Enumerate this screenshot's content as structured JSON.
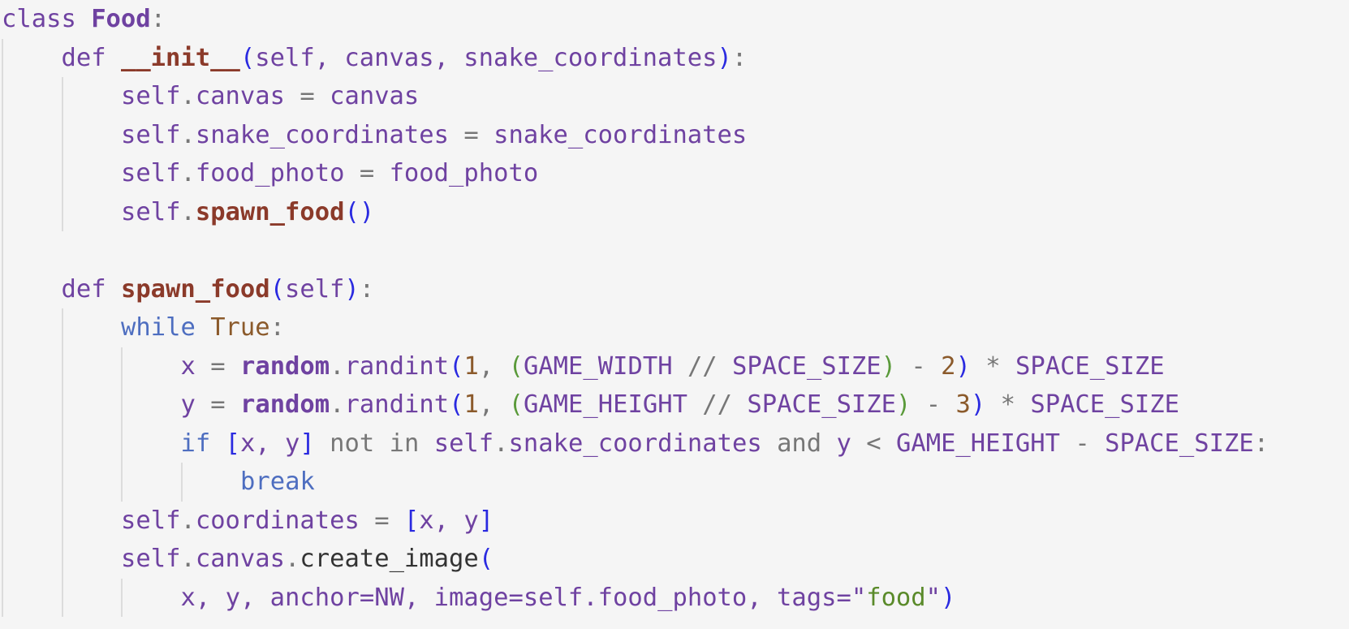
{
  "lines": [
    {
      "indent": 0,
      "guides": [],
      "tokens": [
        [
          "kw",
          "class "
        ],
        [
          "cls",
          "Food"
        ],
        [
          "op",
          ":"
        ]
      ]
    },
    {
      "indent": 1,
      "guides": [
        0
      ],
      "tokens": [
        [
          "kw",
          "def "
        ],
        [
          "fn",
          "__init__"
        ],
        [
          "p1",
          "("
        ],
        [
          "plain",
          "self, canvas, snake_coordinates"
        ],
        [
          "p1",
          ")"
        ],
        [
          "op",
          ":"
        ]
      ]
    },
    {
      "indent": 2,
      "guides": [
        0,
        1
      ],
      "tokens": [
        [
          "plain",
          "self"
        ],
        [
          "op",
          "."
        ],
        [
          "plain",
          "canvas "
        ],
        [
          "op",
          "= "
        ],
        [
          "plain",
          "canvas"
        ]
      ]
    },
    {
      "indent": 2,
      "guides": [
        0,
        1
      ],
      "tokens": [
        [
          "plain",
          "self"
        ],
        [
          "op",
          "."
        ],
        [
          "plain",
          "snake_coordinates "
        ],
        [
          "op",
          "= "
        ],
        [
          "plain",
          "snake_coordinates"
        ]
      ]
    },
    {
      "indent": 2,
      "guides": [
        0,
        1
      ],
      "tokens": [
        [
          "plain",
          "self"
        ],
        [
          "op",
          "."
        ],
        [
          "plain",
          "food_photo "
        ],
        [
          "op",
          "= "
        ],
        [
          "plain",
          "food_photo"
        ]
      ]
    },
    {
      "indent": 2,
      "guides": [
        0,
        1
      ],
      "tokens": [
        [
          "plain",
          "self"
        ],
        [
          "op",
          "."
        ],
        [
          "fn",
          "spawn_food"
        ],
        [
          "p1",
          "()"
        ]
      ]
    },
    {
      "indent": 0,
      "guides": [
        0
      ],
      "tokens": []
    },
    {
      "indent": 1,
      "guides": [
        0
      ],
      "tokens": [
        [
          "kw",
          "def "
        ],
        [
          "fn",
          "spawn_food"
        ],
        [
          "p1",
          "("
        ],
        [
          "plain",
          "self"
        ],
        [
          "p1",
          ")"
        ],
        [
          "op",
          ":"
        ]
      ]
    },
    {
      "indent": 2,
      "guides": [
        0,
        1
      ],
      "tokens": [
        [
          "ctl",
          "while "
        ],
        [
          "const",
          "True"
        ],
        [
          "op",
          ":"
        ]
      ]
    },
    {
      "indent": 3,
      "guides": [
        0,
        1,
        2
      ],
      "tokens": [
        [
          "plain",
          "x "
        ],
        [
          "op",
          "= "
        ],
        [
          "mod",
          "random"
        ],
        [
          "op",
          "."
        ],
        [
          "plain",
          "randint"
        ],
        [
          "p1",
          "("
        ],
        [
          "num",
          "1"
        ],
        [
          "op",
          ", "
        ],
        [
          "p2",
          "("
        ],
        [
          "plain",
          "GAME_WIDTH "
        ],
        [
          "op",
          "// "
        ],
        [
          "plain",
          "SPACE_SIZE"
        ],
        [
          "p2",
          ")"
        ],
        [
          "op",
          " - "
        ],
        [
          "num",
          "2"
        ],
        [
          "p1",
          ")"
        ],
        [
          "op",
          " * "
        ],
        [
          "plain",
          "SPACE_SIZE"
        ]
      ]
    },
    {
      "indent": 3,
      "guides": [
        0,
        1,
        2
      ],
      "tokens": [
        [
          "plain",
          "y "
        ],
        [
          "op",
          "= "
        ],
        [
          "mod",
          "random"
        ],
        [
          "op",
          "."
        ],
        [
          "plain",
          "randint"
        ],
        [
          "p1",
          "("
        ],
        [
          "num",
          "1"
        ],
        [
          "op",
          ", "
        ],
        [
          "p2",
          "("
        ],
        [
          "plain",
          "GAME_HEIGHT "
        ],
        [
          "op",
          "// "
        ],
        [
          "plain",
          "SPACE_SIZE"
        ],
        [
          "p2",
          ")"
        ],
        [
          "op",
          " - "
        ],
        [
          "num",
          "3"
        ],
        [
          "p1",
          ")"
        ],
        [
          "op",
          " * "
        ],
        [
          "plain",
          "SPACE_SIZE"
        ]
      ]
    },
    {
      "indent": 3,
      "guides": [
        0,
        1,
        2
      ],
      "tokens": [
        [
          "ctl",
          "if "
        ],
        [
          "p1",
          "["
        ],
        [
          "plain",
          "x, y"
        ],
        [
          "p1",
          "]"
        ],
        [
          "op",
          " not in "
        ],
        [
          "plain",
          "self"
        ],
        [
          "op",
          "."
        ],
        [
          "plain",
          "snake_coordinates "
        ],
        [
          "op",
          "and "
        ],
        [
          "plain",
          "y "
        ],
        [
          "op",
          "< "
        ],
        [
          "plain",
          "GAME_HEIGHT "
        ],
        [
          "op",
          "- "
        ],
        [
          "plain",
          "SPACE_SIZE"
        ],
        [
          "op",
          ":"
        ]
      ]
    },
    {
      "indent": 4,
      "guides": [
        0,
        1,
        2,
        3
      ],
      "tokens": [
        [
          "ctl",
          "break"
        ]
      ]
    },
    {
      "indent": 2,
      "guides": [
        0,
        1
      ],
      "tokens": [
        [
          "plain",
          "self"
        ],
        [
          "op",
          "."
        ],
        [
          "plain",
          "coordinates "
        ],
        [
          "op",
          "= "
        ],
        [
          "p1",
          "["
        ],
        [
          "plain",
          "x, y"
        ],
        [
          "p1",
          "]"
        ]
      ]
    },
    {
      "indent": 2,
      "guides": [
        0,
        1
      ],
      "tokens": [
        [
          "plain",
          "self"
        ],
        [
          "op",
          "."
        ],
        [
          "plain",
          "canvas"
        ],
        [
          "op",
          "."
        ],
        [
          "call",
          "create_image"
        ],
        [
          "p1",
          "("
        ]
      ]
    },
    {
      "indent": 3,
      "guides": [
        0,
        1,
        2
      ],
      "tokens": [
        [
          "plain",
          "x, y, anchor=NW, image=self.food_photo, tags="
        ],
        [
          "plain",
          "\""
        ],
        [
          "str",
          "food"
        ],
        [
          "plain",
          "\""
        ],
        [
          "p1",
          ")"
        ]
      ]
    }
  ]
}
